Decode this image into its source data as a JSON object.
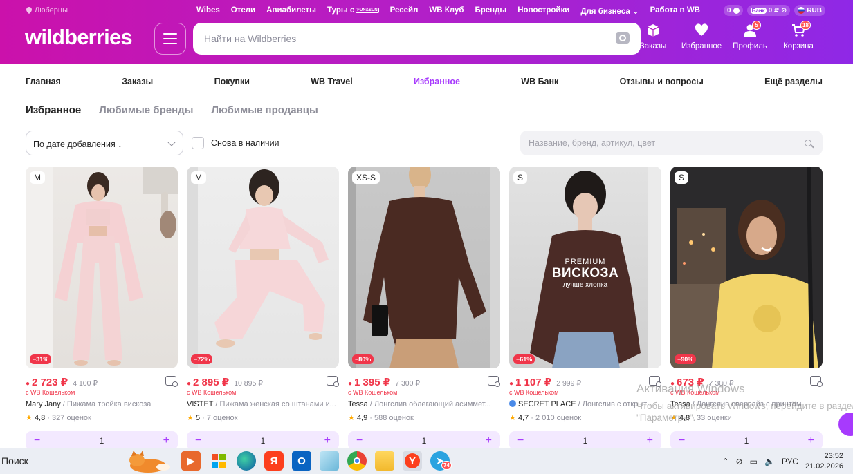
{
  "header": {
    "location": "Люберцы",
    "top_nav": [
      "Wibes",
      "Отели",
      "Авиабилеты",
      "Туры с",
      "Ресейл",
      "WB Клуб",
      "Бренды",
      "Новостройки",
      "Для бизнеса",
      "Работа в WB"
    ],
    "tours_tag": "FUN&SUN",
    "pills": {
      "points": "0",
      "bank_label": "Банк",
      "bank_balance": "0 ₽",
      "currency": "RUB"
    },
    "logo": "wildberries",
    "search_placeholder": "Найти на Wildberries",
    "actions": [
      {
        "label": "Заказы",
        "icon": "box-icon"
      },
      {
        "label": "Избранное",
        "icon": "heart-icon"
      },
      {
        "label": "Профиль",
        "icon": "user-icon",
        "badge": "5"
      },
      {
        "label": "Корзина",
        "icon": "cart-icon",
        "badge": "18"
      }
    ],
    "brand_colors": {
      "gradient_start": "#cb11ab",
      "gradient_end": "#8f28e6",
      "accent": "#a73afd",
      "sale": "#f0364a"
    }
  },
  "account_menu": {
    "items": [
      "Главная",
      "Заказы",
      "Покупки",
      "WB Travel",
      "Избранное",
      "WB Банк",
      "Отзывы и вопросы",
      "Ещё разделы"
    ],
    "active": "Избранное"
  },
  "tabs": {
    "items": [
      "Избранное",
      "Любимые бренды",
      "Любимые продавцы"
    ],
    "active": "Избранное"
  },
  "filters": {
    "sort_value": "По дате добавления ↓",
    "in_stock_label": "Снова в наличии",
    "search_placeholder": "Название, бренд, артикул, цвет"
  },
  "products": [
    {
      "size": "M",
      "discount": "−31%",
      "price": "2 723 ₽",
      "old_price": "4 100 ₽",
      "wallet": "с WB Кошельком",
      "brand": "Mary Jany",
      "name": "Пижама тройка вискоза",
      "rating": "4,8",
      "reviews": "327 оценок",
      "verified": false,
      "qty": "1"
    },
    {
      "size": "M",
      "discount": "−72%",
      "price": "2 895 ₽",
      "old_price": "10 895 ₽",
      "wallet": "с WB Кошельком",
      "brand": "VISTET",
      "name": "Пижама женская со штанами и...",
      "rating": "5",
      "reviews": "7 оценок",
      "verified": false,
      "qty": "1"
    },
    {
      "size": "XS-S",
      "discount": "−80%",
      "price": "1 395 ₽",
      "old_price": "7 300 ₽",
      "wallet": "с WB Кошельком",
      "brand": "Tessa",
      "name": "Лонгслив облегающий асиммет...",
      "rating": "4,9",
      "reviews": "588 оценок",
      "verified": false,
      "qty": "1"
    },
    {
      "size": "S",
      "discount": "−61%",
      "price": "1 107 ₽",
      "old_price": "2 999 ₽",
      "wallet": "с WB Кошельком",
      "brand": "SECRET PLACE",
      "name": "Лонгслив с открыт...",
      "rating": "4,7",
      "reviews": "2 010 оценок",
      "verified": true,
      "qty": "1",
      "photo_text": {
        "line1": "PREMIUM",
        "line2": "ВИСКОЗА",
        "line3": "лучше хлопка"
      }
    },
    {
      "size": "S",
      "discount": "−90%",
      "price": "673 ₽",
      "old_price": "7 300 ₽",
      "wallet": "с WB Кошельком",
      "brand": "Tessa",
      "name": "Лонгслив оверсайз с принтом",
      "rating": "4,8",
      "reviews": "33 оценки",
      "verified": false,
      "qty": "1"
    }
  ],
  "windows": {
    "activation_title": "Активация Windows",
    "activation_text": "Чтобы активировать Windows, перейдите в раздел \"Параметры\".",
    "search_label": "Поиск",
    "telegram_badge": "74",
    "lang": "РУС",
    "time": "23:52",
    "date": "21.02.2026"
  }
}
